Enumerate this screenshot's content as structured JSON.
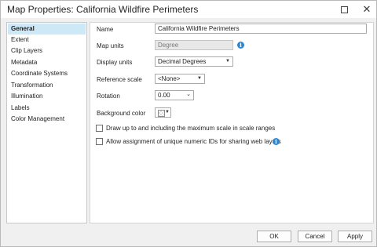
{
  "window": {
    "title": "Map Properties: California Wildfire Perimeters"
  },
  "sidebar": {
    "items": [
      {
        "label": "General",
        "active": true
      },
      {
        "label": "Extent"
      },
      {
        "label": "Clip Layers"
      },
      {
        "label": "Metadata"
      },
      {
        "label": "Coordinate Systems"
      },
      {
        "label": "Transformation"
      },
      {
        "label": "Illumination"
      },
      {
        "label": "Labels"
      },
      {
        "label": "Color Management"
      }
    ]
  },
  "general": {
    "name_label": "Name",
    "name_value": "California Wildfire Perimeters",
    "map_units_label": "Map units",
    "map_units_value": "Degree",
    "display_units_label": "Display units",
    "display_units_value": "Decimal Degrees",
    "reference_scale_label": "Reference scale",
    "reference_scale_value": "<None>",
    "rotation_label": "Rotation",
    "rotation_value": "0.00",
    "background_color_label": "Background color",
    "draw_scale_label": "Draw up to and including the maximum scale in scale ranges",
    "draw_scale_checked": false,
    "unique_ids_label": "Allow assignment of unique numeric IDs for sharing web layers",
    "unique_ids_checked": false
  },
  "footer": {
    "ok": "OK",
    "cancel": "Cancel",
    "apply": "Apply"
  },
  "icons": {
    "info": "info-icon",
    "maximize": "maximize-icon",
    "close": "close-icon",
    "dropdown": "chevron-down-icon"
  },
  "colors": {
    "selection": "#cde8f7",
    "info": "#2f86d1"
  }
}
